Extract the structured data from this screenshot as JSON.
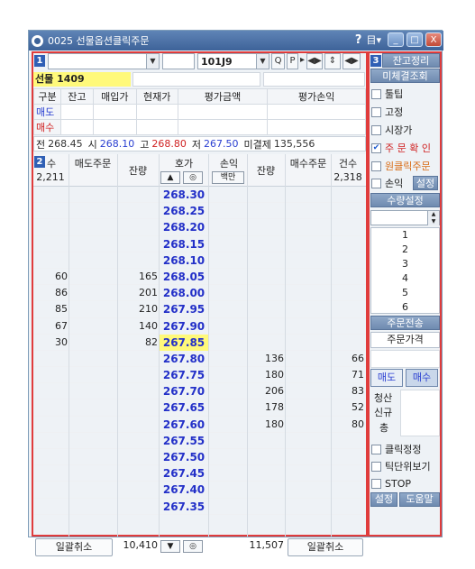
{
  "window": {
    "title": "0025 선물옵션클릭주문",
    "help": "?",
    "menu": "目▾",
    "minimize": "_",
    "maximize": "□",
    "close": "X"
  },
  "section_tags": {
    "one": "1",
    "two": "2",
    "three": "3"
  },
  "top": {
    "account_value": "",
    "code_value": "",
    "product_code": "101J9",
    "btn_search": "Q",
    "btn_p": "P",
    "btn_arrow1": "◀▶",
    "btn_arrow2": "⇕",
    "btn_arrow3": "◀▶"
  },
  "product": {
    "name": "선물  1409"
  },
  "position": {
    "headers": [
      "구분",
      "잔고",
      "매입가",
      "현재가",
      "평가금액",
      "평가손익"
    ],
    "sell_label": "매도",
    "buy_label": "매수"
  },
  "price_line": {
    "prev_label": "전",
    "prev": "268.45",
    "open_label": "시",
    "open": "268.10",
    "high_label": "고",
    "high": "268.80",
    "low_label": "저",
    "low": "267.50",
    "oi_label": "미결제",
    "oi": "135,556"
  },
  "book": {
    "hdr_count": "수",
    "hdr_sell_order": "매도주문",
    "hdr_qty_left": "잔량",
    "hdr_price": "호가",
    "hdr_pnl": "손익",
    "hdr_qty_right": "잔량",
    "hdr_buy_order": "매수주문",
    "hdr_count_right": "건수",
    "pnl_button": "백만",
    "sell_total_count": "2,211",
    "buy_total_count": "2,318",
    "up_btn": "▲",
    "center_btn": "◎",
    "down_btn": "▼",
    "rows": [
      {
        "cnt": "",
        "qty": "",
        "price": "268.30",
        "bqty": "",
        "bcnt": ""
      },
      {
        "cnt": "",
        "qty": "",
        "price": "268.25",
        "bqty": "",
        "bcnt": ""
      },
      {
        "cnt": "",
        "qty": "",
        "price": "268.20",
        "bqty": "",
        "bcnt": ""
      },
      {
        "cnt": "",
        "qty": "",
        "price": "268.15",
        "bqty": "",
        "bcnt": ""
      },
      {
        "cnt": "",
        "qty": "",
        "price": "268.10",
        "bqty": "",
        "bcnt": ""
      },
      {
        "cnt": "60",
        "qty": "165",
        "price": "268.05",
        "bqty": "",
        "bcnt": ""
      },
      {
        "cnt": "86",
        "qty": "201",
        "price": "268.00",
        "bqty": "",
        "bcnt": ""
      },
      {
        "cnt": "85",
        "qty": "210",
        "price": "267.95",
        "bqty": "",
        "bcnt": ""
      },
      {
        "cnt": "67",
        "qty": "140",
        "price": "267.90",
        "bqty": "",
        "bcnt": ""
      },
      {
        "cnt": "30",
        "qty": "82",
        "price": "267.85",
        "bqty": "",
        "bcnt": ""
      },
      {
        "cnt": "",
        "qty": "",
        "price": "267.80",
        "bqty": "136",
        "bcnt": "66"
      },
      {
        "cnt": "",
        "qty": "",
        "price": "267.75",
        "bqty": "180",
        "bcnt": "71"
      },
      {
        "cnt": "",
        "qty": "",
        "price": "267.70",
        "bqty": "206",
        "bcnt": "83"
      },
      {
        "cnt": "",
        "qty": "",
        "price": "267.65",
        "bqty": "178",
        "bcnt": "52"
      },
      {
        "cnt": "",
        "qty": "",
        "price": "267.60",
        "bqty": "180",
        "bcnt": "80"
      },
      {
        "cnt": "",
        "qty": "",
        "price": "267.55",
        "bqty": "",
        "bcnt": ""
      },
      {
        "cnt": "",
        "qty": "",
        "price": "267.50",
        "bqty": "",
        "bcnt": ""
      },
      {
        "cnt": "",
        "qty": "",
        "price": "267.45",
        "bqty": "",
        "bcnt": ""
      },
      {
        "cnt": "",
        "qty": "",
        "price": "267.40",
        "bqty": "",
        "bcnt": ""
      },
      {
        "cnt": "",
        "qty": "",
        "price": "267.35",
        "bqty": "",
        "bcnt": ""
      }
    ],
    "current_price_index": 9,
    "foot_cancel_left": "일괄취소",
    "foot_sell_total": "10,410",
    "foot_buy_total": "11,507",
    "foot_cancel_right": "일괄취소"
  },
  "right": {
    "btn_balance": "잔고정리",
    "btn_unfilled": "미체결조회",
    "chk_tooltip": "툴팁",
    "chk_fixed": "고정",
    "chk_market": "시장가",
    "chk_confirm": "주 문 확 인",
    "chk_oneclick": "원클릭주문",
    "chk_pnl": "손익",
    "btn_pnl_setting": "설정",
    "btn_qty_setting": "수량설정",
    "qty_options": [
      "1",
      "2",
      "3",
      "4",
      "5",
      "6"
    ],
    "btn_send": "주문전송",
    "order_price_label": "주문가격",
    "btn_sell": "매도",
    "btn_buy": "매수",
    "lbl_close": "청산",
    "lbl_new": "신규",
    "lbl_total": "총",
    "chk_click_modify": "클릭정정",
    "chk_tick": "틱단위보기",
    "chk_stop": "STOP",
    "btn_setting": "설정",
    "btn_help": "도움말"
  }
}
